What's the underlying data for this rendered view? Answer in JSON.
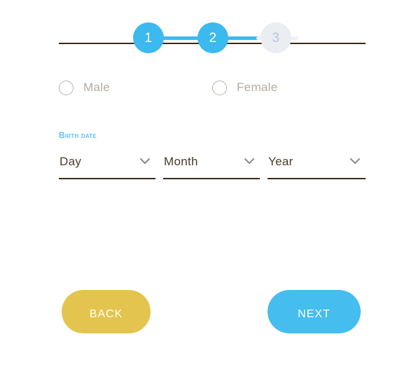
{
  "stepper": {
    "steps": [
      {
        "number": "1",
        "state": "active"
      },
      {
        "number": "2",
        "state": "active"
      },
      {
        "number": "3",
        "state": "inactive"
      }
    ],
    "active_color": "#3cb9ee",
    "inactive_color": "#eaedf2",
    "inactive_text_color": "#b8c6db",
    "baseline_color": "#3b2a16",
    "track_empty_color": "#eef1f5"
  },
  "gender": {
    "options": [
      {
        "label": "Male",
        "selected": false
      },
      {
        "label": "Female",
        "selected": false
      }
    ],
    "label_color": "#b3aba1",
    "ring_color": "#b9b4ad"
  },
  "birth_date": {
    "label": "Birth date",
    "label_color": "#5ec3f2",
    "fields": [
      {
        "value": "Day",
        "icon": "chevron-down-icon"
      },
      {
        "value": "Month",
        "icon": "chevron-down-icon"
      },
      {
        "value": "Year",
        "icon": "chevron-down-icon"
      }
    ],
    "value_color": "#4a3b2a",
    "underline_color": "#3b2a16",
    "chevron_color": "#8a8a8a"
  },
  "actions": {
    "back_label": "Back",
    "back_color": "#e3c44f",
    "next_label": "Next",
    "next_color": "#45bdef",
    "text_color": "#ffffff"
  }
}
